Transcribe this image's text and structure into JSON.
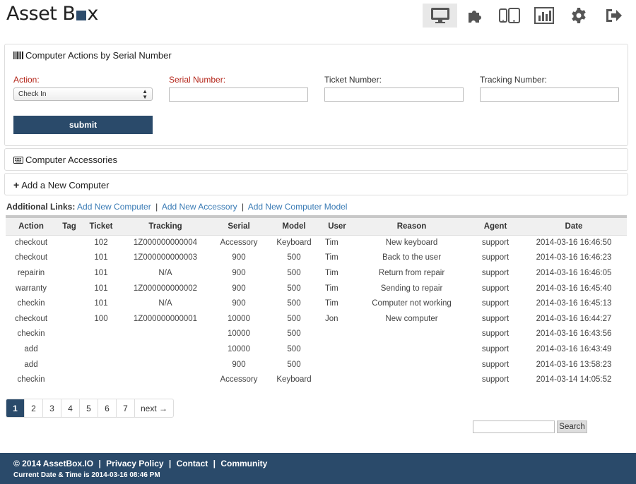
{
  "app": {
    "logo_text_before": "Asset B",
    "logo_text_after": "x"
  },
  "nav": {
    "icons": [
      "monitor-icon",
      "puzzle-icon",
      "devices-icon",
      "chart-icon",
      "gear-icon",
      "logout-icon"
    ],
    "active": "monitor-icon"
  },
  "actions_panel": {
    "title": "Computer Actions by Serial Number",
    "action_label": "Action:",
    "action_value": "Check In",
    "serial_label": "Serial Number:",
    "serial_value": "",
    "ticket_label": "Ticket Number:",
    "ticket_value": "",
    "tracking_label": "Tracking Number:",
    "tracking_value": "",
    "submit_label": "submit"
  },
  "accessories_panel": {
    "title": "Computer Accessories"
  },
  "add_computer_panel": {
    "title": "Add a New Computer"
  },
  "links": {
    "label": "Additional Links:",
    "add_computer": "Add New Computer",
    "add_accessory": "Add New Accessory",
    "add_model": "Add New Computer Model",
    "separator": "|"
  },
  "table": {
    "headers": [
      "Action",
      "Tag",
      "Ticket",
      "Tracking",
      "Serial",
      "Model",
      "User",
      "Reason",
      "Agent",
      "Date"
    ],
    "rows": [
      [
        "checkout",
        "",
        "102",
        "1Z000000000004",
        "Accessory",
        "Keyboard",
        "Tim",
        "New keyboard",
        "support",
        "2014-03-16 16:46:50"
      ],
      [
        "checkout",
        "",
        "101",
        "1Z000000000003",
        "900",
        "500",
        "Tim",
        "Back to the user",
        "support",
        "2014-03-16 16:46:23"
      ],
      [
        "repairin",
        "",
        "101",
        "N/A",
        "900",
        "500",
        "Tim",
        "Return from repair",
        "support",
        "2014-03-16 16:46:05"
      ],
      [
        "warranty",
        "",
        "101",
        "1Z000000000002",
        "900",
        "500",
        "Tim",
        "Sending to repair",
        "support",
        "2014-03-16 16:45:40"
      ],
      [
        "checkin",
        "",
        "101",
        "N/A",
        "900",
        "500",
        "Tim",
        "Computer not working",
        "support",
        "2014-03-16 16:45:13"
      ],
      [
        "checkout",
        "",
        "100",
        "1Z000000000001",
        "10000",
        "500",
        "Jon",
        "New computer",
        "support",
        "2014-03-16 16:44:27"
      ],
      [
        "checkin",
        "",
        "",
        "",
        "10000",
        "500",
        "",
        "",
        "support",
        "2014-03-16 16:43:56"
      ],
      [
        "add",
        "",
        "",
        "",
        "10000",
        "500",
        "",
        "",
        "support",
        "2014-03-16 16:43:49"
      ],
      [
        "add",
        "",
        "",
        "",
        "900",
        "500",
        "",
        "",
        "support",
        "2014-03-16 13:58:23"
      ],
      [
        "checkin",
        "",
        "",
        "",
        "Accessory",
        "Keyboard",
        "",
        "",
        "support",
        "2014-03-14 14:05:52"
      ]
    ]
  },
  "pagination": {
    "pages": [
      "1",
      "2",
      "3",
      "4",
      "5",
      "6",
      "7"
    ],
    "current": "1",
    "next_label": "next →"
  },
  "search": {
    "value": "",
    "button_label": "Search"
  },
  "footer": {
    "copyright": "© 2014 AssetBox.IO",
    "privacy": "Privacy Policy",
    "contact": "Contact",
    "community": "Community",
    "separator": "|",
    "datetime": "Current Date & Time is 2014-03-16 08:46 PM"
  },
  "colors": {
    "primary": "#2a4a6a",
    "required_label": "#b4261a",
    "link": "#3a7bb5"
  }
}
